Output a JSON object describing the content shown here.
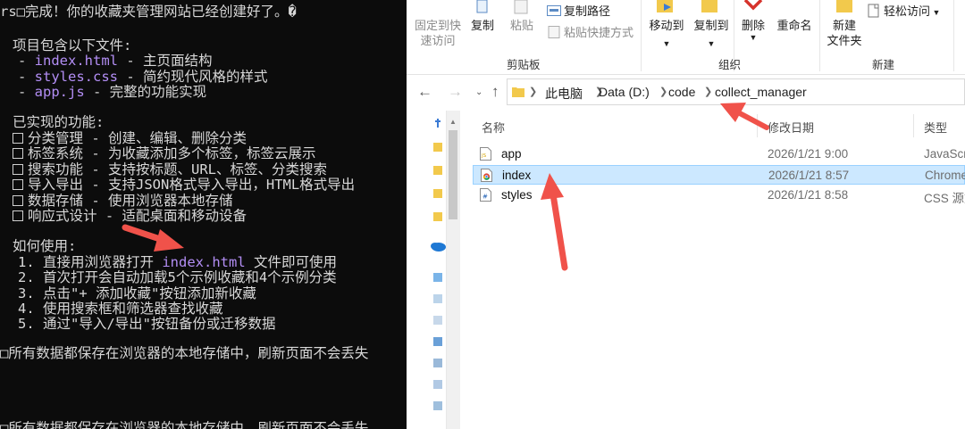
{
  "terminal": {
    "lines": [
      {
        "text": "rs□完成！你的收藏夹管理网站已经创建好了。�"
      },
      {
        "text": "项目包含以下文件:"
      },
      {
        "file": "index.html",
        "desc": " - 主页面结构"
      },
      {
        "file": "styles.css",
        "desc": " - 简约现代风格的样式"
      },
      {
        "file": "app.js",
        "desc": " - 完整的功能实现"
      },
      {
        "text": "已实现的功能:"
      },
      {
        "text": "分类管理 - 创建、编辑、删除分类"
      },
      {
        "text": "标签系统 - 为收藏添加多个标签，标签云展示"
      },
      {
        "text": "搜索功能 - 支持按标题、URL、标签、分类搜索"
      },
      {
        "text": "导入导出 - 支持JSON格式导入导出，HTML格式导出"
      },
      {
        "text": "数据存储 - 使用浏览器本地存储"
      },
      {
        "text": "响应式设计 - 适配桌面和移动设备"
      },
      {
        "text": "如何使用:"
      },
      {
        "pre": "1. 直接用浏览器打开 ",
        "file": "index.html",
        "post": " 文件即可使用"
      },
      {
        "text": "2. 首次打开会自动加载5个示例收藏和4个示例分类"
      },
      {
        "text": "3. 点击\"+ 添加收藏\"按钮添加新收藏"
      },
      {
        "text": "4. 使用搜索框和筛选器查找收藏"
      },
      {
        "text": "5. 通过\"导入/导出\"按钮备份或迁移数据"
      },
      {
        "text": "□所有数据都保存在浏览器的本地存储中，刷新页面不会丢失"
      },
      {
        "text": "□所有数据都保存在浏览器的本地存储中，刷新页面不会丢失"
      }
    ],
    "colors": {
      "bg": "#0c0c0c",
      "text": "#d8d8d8",
      "filename": "#b38ef5"
    }
  },
  "ribbon": {
    "pin_label_1": "固定到快",
    "pin_label_2": "速访问",
    "copy": "复制",
    "paste": "粘贴",
    "copy_path": "复制路径",
    "paste_shortcut": "粘贴快捷方式",
    "group_clipboard": "剪贴板",
    "move_to": "移动到",
    "copy_to": "复制到",
    "delete": "删除",
    "rename": "重命名",
    "group_organize": "组织",
    "new_folder_1": "新建",
    "new_folder_2": "文件夹",
    "easy_access": "轻松访问",
    "group_new": "新建"
  },
  "address": {
    "crumbs": [
      "此电脑",
      "Data (D:)",
      "code",
      "collect_manager"
    ]
  },
  "filelist": {
    "columns": {
      "name": "名称",
      "date": "修改日期",
      "type": "类型"
    },
    "rows": [
      {
        "name": "app",
        "date": "2026/1/21 9:00",
        "type": "JavaScr",
        "icon": "js-file-icon",
        "selected": false
      },
      {
        "name": "index",
        "date": "2026/1/21 8:57",
        "type": "Chrome",
        "icon": "chrome-html-file-icon",
        "selected": true
      },
      {
        "name": "styles",
        "date": "2026/1/21 8:58",
        "type": "CSS 源文",
        "icon": "css-file-icon",
        "selected": false
      }
    ]
  },
  "colors": {
    "selection_bg": "#cce8ff",
    "selection_border": "#99d1ff",
    "annotation_arrow": "#f0524a",
    "folder_yellow": "#f2c94c",
    "delete_red": "#d6332c"
  }
}
